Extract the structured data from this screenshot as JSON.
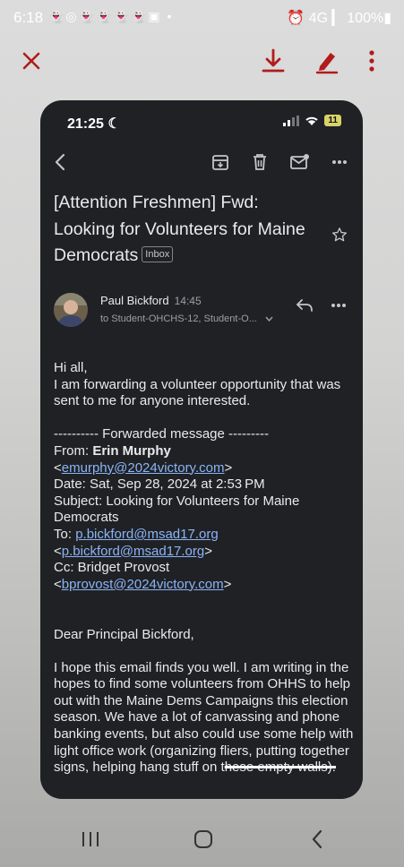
{
  "device_status": {
    "time": "6:18",
    "notifications": "👻◎👻👻👻👻▣ •",
    "right": "⏰ 4G ▎ 100%▮"
  },
  "viewer": {
    "close_icon": "close-icon",
    "download_icon": "download-icon",
    "edit_icon": "pen-icon",
    "more_icon": "more-vert-icon",
    "accent": "#b01c1c"
  },
  "phone_status": {
    "time": "21:25",
    "battery": "11"
  },
  "email": {
    "subject": "[Attention Freshmen] Fwd: Looking for Volunteers for Maine Democrats",
    "label": "Inbox",
    "sender": "Paul Bickford",
    "time": "14:45",
    "recipients": "to Student-OHCHS-12, Student-O...",
    "greeting": "Hi all,",
    "intro": "I am forwarding a volunteer opportunity that was sent to me for anyone interested.",
    "fwd_header": "---------- Forwarded message ---------",
    "from_label": "From: ",
    "from_name": "Erin Murphy",
    "from_email": "emurphy@2024victory.com",
    "date_line": "Date: Sat, Sep 28, 2024 at 2:53 PM",
    "subject_line": "Subject: Looking for Volunteers for Maine Democrats",
    "to_label": "To: ",
    "to_email": "p.bickford@msad17.org",
    "to_email2": "p.bickford@msad17.org",
    "cc_line": "Cc: Bridget Provost",
    "cc_email": "bprovost@2024victory.com",
    "salutation": "Dear Principal Bickford,",
    "paragraph_start": "I hope this email finds you well. I am writing in the hopes to find some volunteers from OHHS to help out with the Maine Dems Campaigns this election season.  We have a lot of canvassing and phone banking events, but also could use some help with light office work (organizing fliers, putting together signs, helping hang stuff on t",
    "paragraph_struck": "hese empty walls)."
  }
}
